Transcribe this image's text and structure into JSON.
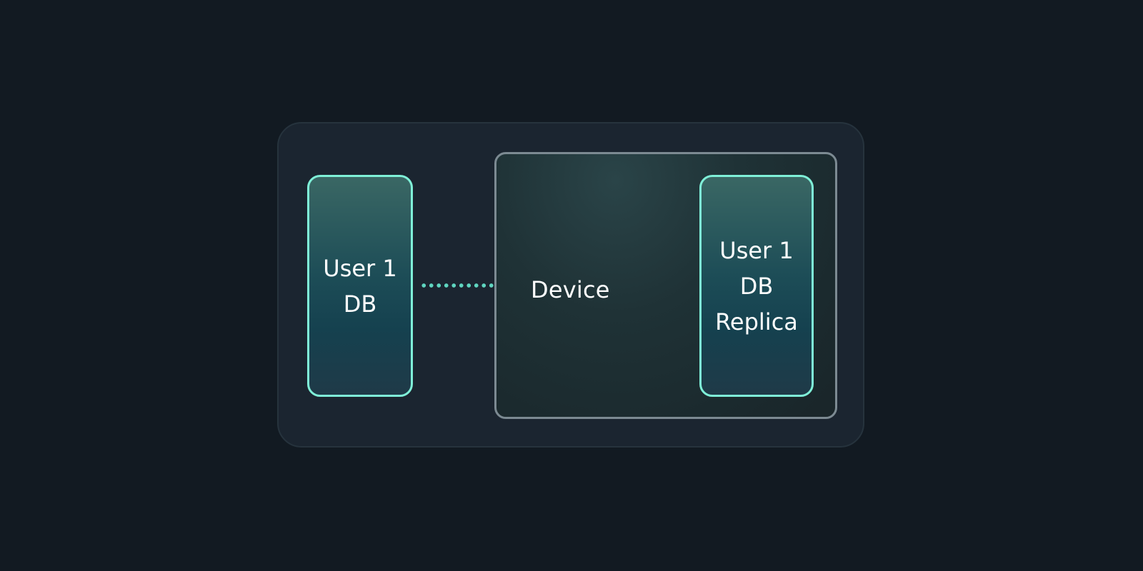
{
  "diagram": {
    "left_node": {
      "lines": [
        "User 1",
        "DB"
      ]
    },
    "device": {
      "label": "Device"
    },
    "right_node": {
      "lines": [
        "User 1",
        "DB",
        "Replica"
      ]
    },
    "connector": {
      "style": "dotted"
    },
    "colors": {
      "background": "#121a22",
      "outer_frame": "#1b2530",
      "db_border": "#7ff0d8",
      "device_border": "#7c8a92",
      "connector": "#5fd6c0",
      "text": "#ffffff"
    }
  }
}
